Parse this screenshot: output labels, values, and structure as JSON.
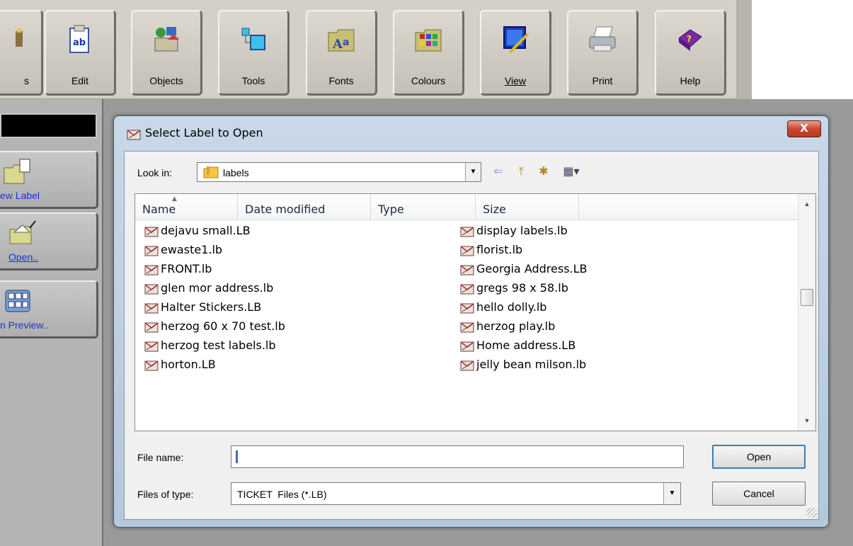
{
  "toolbar": {
    "buttons": [
      {
        "label": "s",
        "icon": "wand-icon"
      },
      {
        "label": "Edit",
        "icon": "edit-icon"
      },
      {
        "label": "Objects",
        "icon": "objects-icon"
      },
      {
        "label": "Tools",
        "icon": "tools-icon"
      },
      {
        "label": "Fonts",
        "icon": "fonts-icon"
      },
      {
        "label": "Colours",
        "icon": "colours-icon"
      },
      {
        "label": "View",
        "icon": "view-icon"
      },
      {
        "label": "Print",
        "icon": "print-icon"
      },
      {
        "label": "Help",
        "icon": "help-icon"
      }
    ]
  },
  "sidebar": {
    "items": [
      {
        "label": "ew Label",
        "icon": "new-label-icon"
      },
      {
        "label": "Open..",
        "icon": "open-folder-icon"
      },
      {
        "label": "n Preview..",
        "icon": "preview-icon"
      }
    ]
  },
  "dialog": {
    "title": "Select Label to Open",
    "close_label": "X",
    "look_in_label": "Look in:",
    "look_in_value": "labels",
    "columns": [
      "Name",
      "Date modified",
      "Type",
      "Size"
    ],
    "files_col1": [
      "dejavu small.LB",
      "ewaste1.lb",
      "FRONT.lb",
      "glen mor address.lb",
      "Halter Stickers.LB",
      "herzog 60 x 70 test.lb",
      "herzog test labels.lb",
      "horton.LB"
    ],
    "files_col2": [
      "display labels.lb",
      "florist.lb",
      "Georgia Address.LB",
      "gregs 98 x 58.lb",
      "hello dolly.lb",
      "herzog play.lb",
      "Home address.LB",
      "jelly bean milson.lb"
    ],
    "file_name_label": "File name:",
    "file_name_value": "",
    "files_of_type_label": "Files of type:",
    "files_of_type_value": "TICKET  Files (*.LB)",
    "open_button": "Open",
    "cancel_button": "Cancel"
  },
  "colors": {
    "toolbar_bg": "#d4d0c8",
    "workspace_bg": "#9a9a9a",
    "dialog_frame": "#b4c8dc",
    "close_button": "#c84830",
    "link_blue": "#1a36c8"
  }
}
